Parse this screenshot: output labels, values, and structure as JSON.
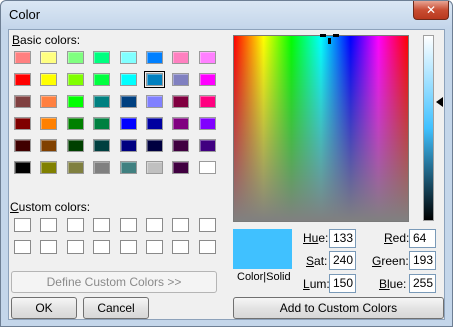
{
  "window": {
    "title": "Color",
    "close_glyph": "✕"
  },
  "labels": {
    "basic_colors": "Basic colors:",
    "basic_colors_key": "B",
    "basic_colors_rest": "asic colors:",
    "custom_colors_key": "C",
    "custom_colors_rest": "ustom colors:",
    "color_solid": "Color|Solid"
  },
  "basic_colors": [
    [
      "#ff8080",
      "#ffff80",
      "#80ff80",
      "#00ff80",
      "#80ffff",
      "#0080ff",
      "#ff80c0",
      "#ff80ff"
    ],
    [
      "#ff0000",
      "#ffff00",
      "#80ff00",
      "#00ff40",
      "#00ffff",
      "#0080c0",
      "#8080c0",
      "#ff00ff"
    ],
    [
      "#804040",
      "#ff8040",
      "#00ff00",
      "#008080",
      "#004080",
      "#8080ff",
      "#800040",
      "#ff0080"
    ],
    [
      "#800000",
      "#ff8000",
      "#008000",
      "#008040",
      "#0000ff",
      "#0000a0",
      "#800080",
      "#8000ff"
    ],
    [
      "#400000",
      "#804000",
      "#004000",
      "#004040",
      "#000080",
      "#000040",
      "#400040",
      "#400080"
    ],
    [
      "#000000",
      "#808000",
      "#808040",
      "#808080",
      "#408080",
      "#c0c0c0",
      "#400040",
      "#ffffff"
    ]
  ],
  "selected_swatch": {
    "row": 1,
    "col": 5
  },
  "custom_colors_count": 16,
  "buttons": {
    "define_custom": "Define Custom Colors >>",
    "ok": "OK",
    "cancel": "Cancel",
    "add_custom": "Add to Custom Colors"
  },
  "fields": {
    "hue": {
      "label_key": "Hu",
      "label_rest": "e:",
      "value": "133"
    },
    "sat": {
      "label_key": "S",
      "label_rest": "at:",
      "value": "240"
    },
    "lum": {
      "label_key": "L",
      "label_rest": "um:",
      "value": "150"
    },
    "red": {
      "label_key": "R",
      "label_rest": "ed:",
      "value": "64"
    },
    "green": {
      "label_key": "G",
      "label_rest": "reen:",
      "value": "193"
    },
    "blue": {
      "label_key": "Bl",
      "label_rest": "ue:",
      "value": "255"
    }
  },
  "current_color": "#40c1ff"
}
